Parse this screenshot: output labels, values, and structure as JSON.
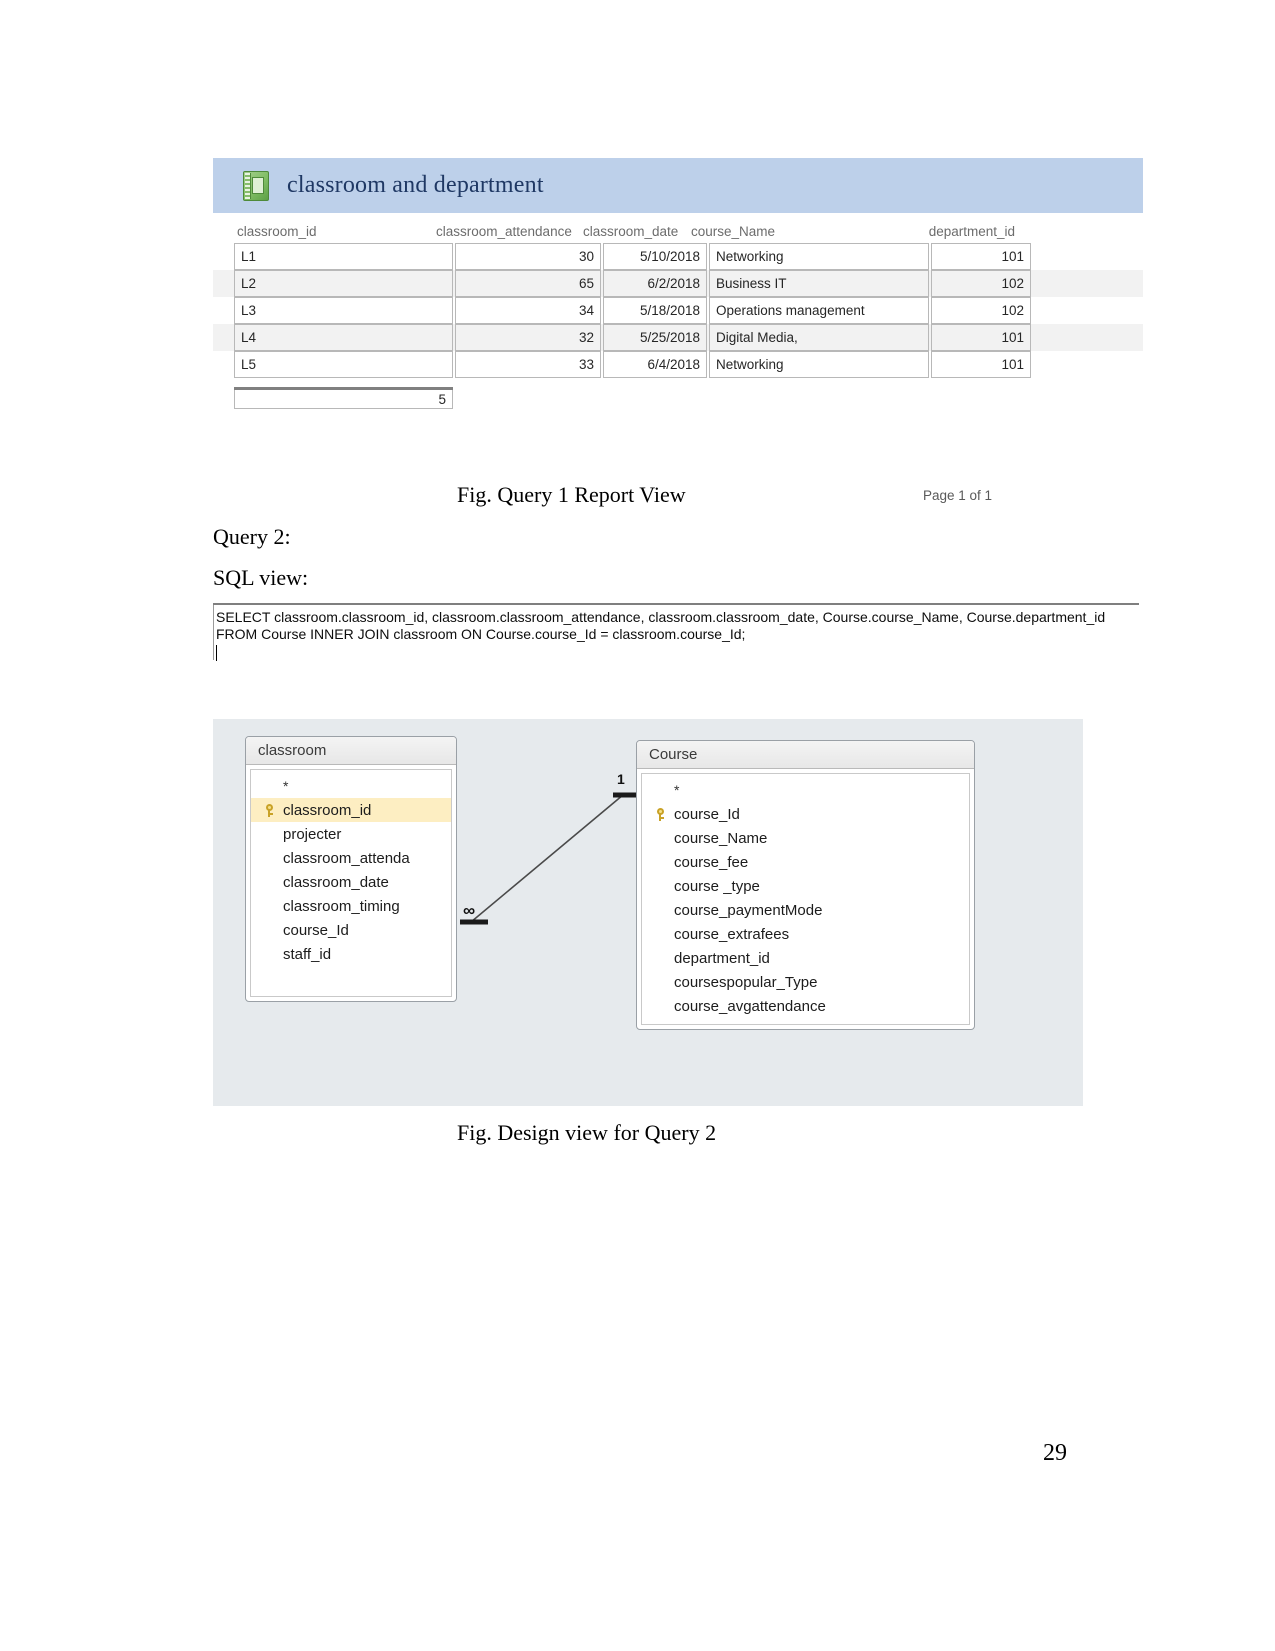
{
  "report": {
    "icon": "report-book-icon",
    "title": "classroom and department",
    "columns": [
      "classroom_id",
      "classroom_attendance",
      "classroom_date",
      "course_Name",
      "department_id"
    ],
    "rows": [
      {
        "classroom_id": "L1",
        "classroom_attendance": "30",
        "classroom_date": "5/10/2018",
        "course_Name": "Networking",
        "department_id": "101"
      },
      {
        "classroom_id": "L2",
        "classroom_attendance": "65",
        "classroom_date": "6/2/2018",
        "course_Name": "Business IT",
        "department_id": "102"
      },
      {
        "classroom_id": "L3",
        "classroom_attendance": "34",
        "classroom_date": "5/18/2018",
        "course_Name": "Operations management",
        "department_id": "102"
      },
      {
        "classroom_id": "L4",
        "classroom_attendance": "32",
        "classroom_date": "5/25/2018",
        "course_Name": "Digital Media,",
        "department_id": "101"
      },
      {
        "classroom_id": "L5",
        "classroom_attendance": "33",
        "classroom_date": "6/4/2018",
        "course_Name": "Networking",
        "department_id": "101"
      }
    ],
    "summary_count": "5",
    "page_of": "Page 1 of 1",
    "header_bg": "#bdd0ea",
    "title_color": "#1f3864"
  },
  "captions": {
    "figure1": "Fig. Query 1 Report View",
    "query_label": "Query 2:",
    "sql_view_label": "SQL view:",
    "figure2": "Fig. Design view for Query 2"
  },
  "sql": {
    "line1": "SELECT classroom.classroom_id, classroom.classroom_attendance, classroom.classroom_date, Course.course_Name, Course.department_id",
    "line2": "FROM Course INNER JOIN classroom ON Course.course_Id = classroom.course_Id;"
  },
  "design_view": {
    "background": "#e6eaed",
    "tables": [
      {
        "name": "classroom",
        "asterisk": "*",
        "fields": [
          {
            "label": "classroom_id",
            "primary_key": true
          },
          {
            "label": "projecter",
            "primary_key": false
          },
          {
            "label": "classroom_attenda",
            "primary_key": false
          },
          {
            "label": "classroom_date",
            "primary_key": false
          },
          {
            "label": "classroom_timing",
            "primary_key": false
          },
          {
            "label": "course_Id",
            "primary_key": false
          },
          {
            "label": "staff_id",
            "primary_key": false
          }
        ]
      },
      {
        "name": "Course",
        "asterisk": "*",
        "fields": [
          {
            "label": "course_Id",
            "primary_key": true
          },
          {
            "label": "course_Name",
            "primary_key": false
          },
          {
            "label": "course_fee",
            "primary_key": false
          },
          {
            "label": "course _type",
            "primary_key": false
          },
          {
            "label": "course_paymentMode",
            "primary_key": false
          },
          {
            "label": "course_extrafees",
            "primary_key": false
          },
          {
            "label": "department_id",
            "primary_key": false
          },
          {
            "label": "coursespopular_Type",
            "primary_key": false
          },
          {
            "label": "course_avgattendance",
            "primary_key": false
          }
        ]
      }
    ],
    "relationship": {
      "one_side_label": "1",
      "many_side_label": "∞"
    }
  },
  "page_number": "29"
}
